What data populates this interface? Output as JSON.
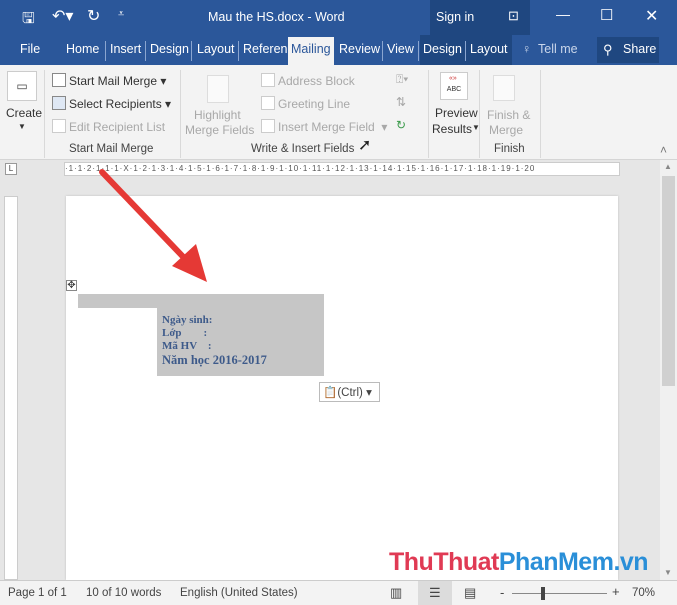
{
  "title": "Mau the HS.docx  -  Word",
  "sign_in": "Sign in",
  "tabs": [
    "File",
    "Home",
    "Insert",
    "Design",
    "Layout",
    "Referen",
    "Mailing",
    "Review",
    "View",
    "Design",
    "Layout"
  ],
  "tell_me": "Tell me",
  "share": "Share",
  "ribbon": {
    "create": "Create",
    "start_mail_merge": "Start Mail Merge",
    "select_recipients": "Select Recipients",
    "edit_recipient_list": "Edit Recipient List",
    "group_start": "Start Mail Merge",
    "highlight1": "Highlight",
    "highlight2": "Merge Fields",
    "address_block": "Address Block",
    "greeting_line": "Greeting Line",
    "insert_merge_field": "Insert Merge Field",
    "group_write": "Write & Insert Fields",
    "preview1": "Preview",
    "preview2": "Results",
    "preview_icon": "ABC",
    "group_preview": "",
    "finish1": "Finish &",
    "finish2": "Merge",
    "group_finish": "Finish"
  },
  "ruler": "·1·1·2·1·1·1·X·1·2·1·3·1·4·1·5·1·6·1·7·1·8·1·9·1·10·1·11·1·12·1·13·1·14·1·15·1·16·1·17·1·18·1·19·1·20",
  "doc": {
    "lines": [
      "Ngày sinh:",
      "Lớp        :",
      "Mã HV    :"
    ],
    "year": "Năm học 2016-2017",
    "paste": "(Ctrl)"
  },
  "watermark": {
    "part1": "ThuThuat",
    "part2": "PhanMem.vn"
  },
  "status": {
    "page": "Page 1 of 1",
    "words": "10 of 10 words",
    "language": "English (United States)",
    "zoom": "70%"
  }
}
